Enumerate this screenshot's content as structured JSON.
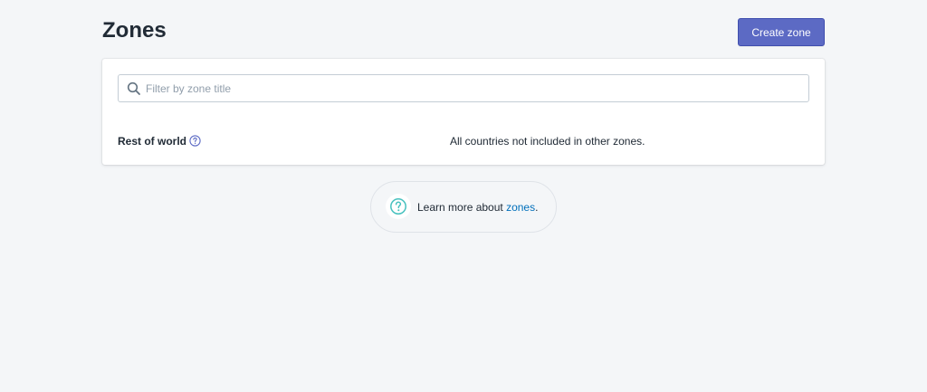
{
  "header": {
    "title": "Zones",
    "create_button_label": "Create zone"
  },
  "search": {
    "placeholder": "Filter by zone title",
    "value": "",
    "icon": "search-icon"
  },
  "zones": [
    {
      "name": "Rest of world",
      "help_icon": "question-circle-icon",
      "description": "All countries not included in other zones."
    }
  ],
  "footer_help": {
    "icon": "question-circle-icon",
    "prefix": "Learn more about ",
    "link_text": "zones",
    "suffix": "."
  },
  "colors": {
    "primary_button": "#5c6ac4",
    "link": "#006fbb",
    "help_icon_teal": "#47c1bf",
    "help_icon_indigo": "#5c6ac4",
    "background": "#f4f6f8"
  }
}
